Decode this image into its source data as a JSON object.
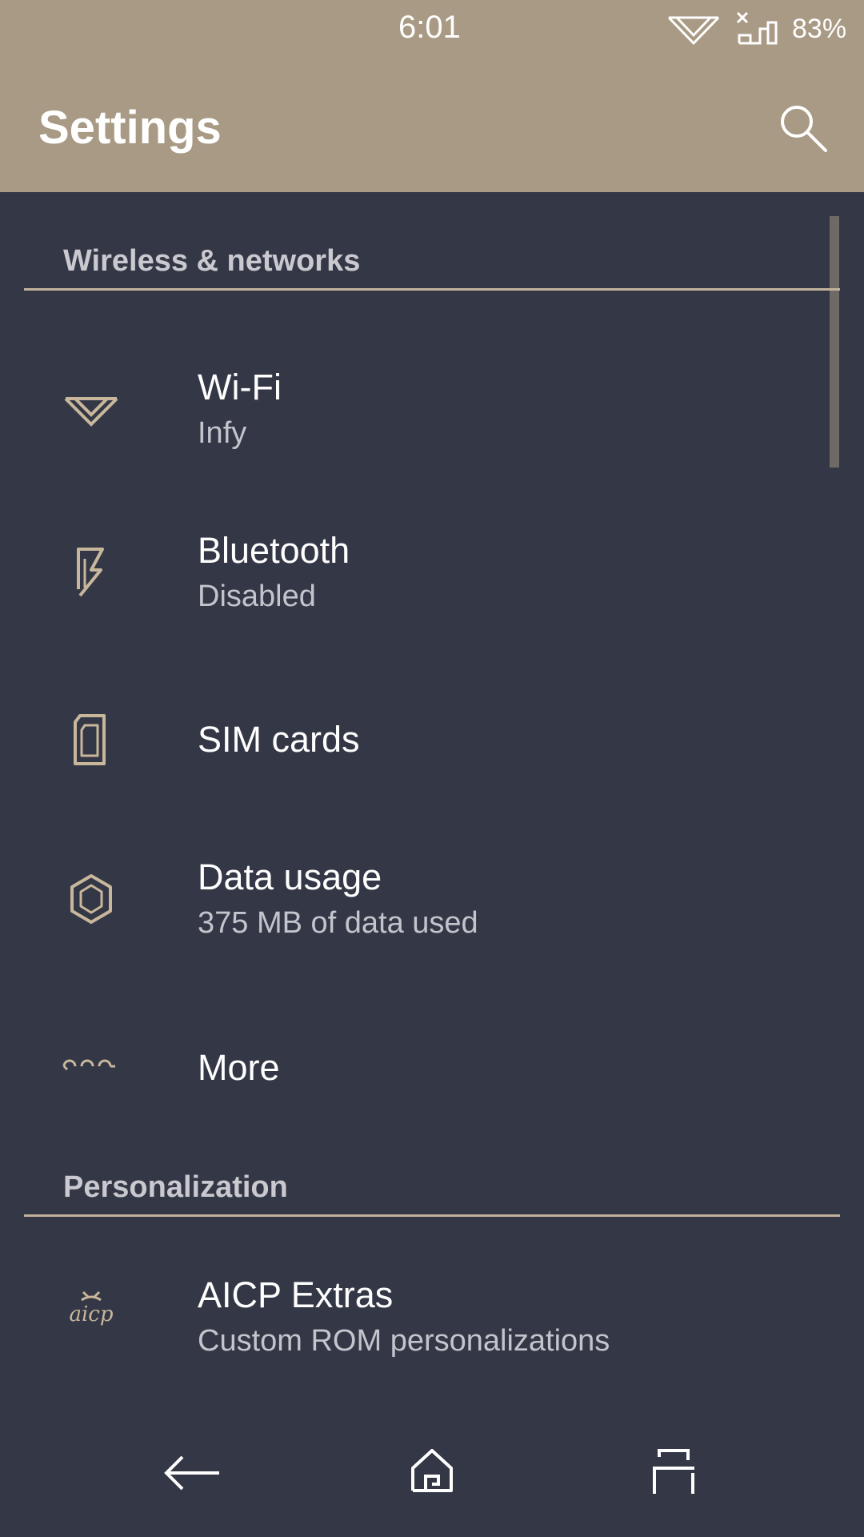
{
  "status_bar": {
    "time": "6:01",
    "battery": "83%",
    "icons": [
      "wifi-icon",
      "signal-no-service-icon"
    ]
  },
  "app_bar": {
    "title": "Settings",
    "search_icon": "search-icon"
  },
  "colors": {
    "header_bg": "#a89a84",
    "content_bg": "#343746",
    "accent": "#c2b39c",
    "icon_tint": "#c9b79c"
  },
  "sections": [
    {
      "title": "Wireless & networks",
      "items": [
        {
          "icon": "wifi-icon",
          "title": "Wi-Fi",
          "summary": "Infy"
        },
        {
          "icon": "bluetooth-icon",
          "title": "Bluetooth",
          "summary": "Disabled"
        },
        {
          "icon": "sim-card-icon",
          "title": "SIM cards",
          "summary": ""
        },
        {
          "icon": "data-usage-icon",
          "title": "Data usage",
          "summary": "375 MB of data used"
        },
        {
          "icon": "more-icon",
          "title": "More",
          "summary": ""
        }
      ]
    },
    {
      "title": "Personalization",
      "items": [
        {
          "icon": "aicp-icon",
          "title": "AICP Extras",
          "summary": "Custom ROM personalizations"
        }
      ]
    }
  ],
  "nav_bar": {
    "buttons": [
      "back-icon",
      "home-icon",
      "recents-icon"
    ]
  }
}
